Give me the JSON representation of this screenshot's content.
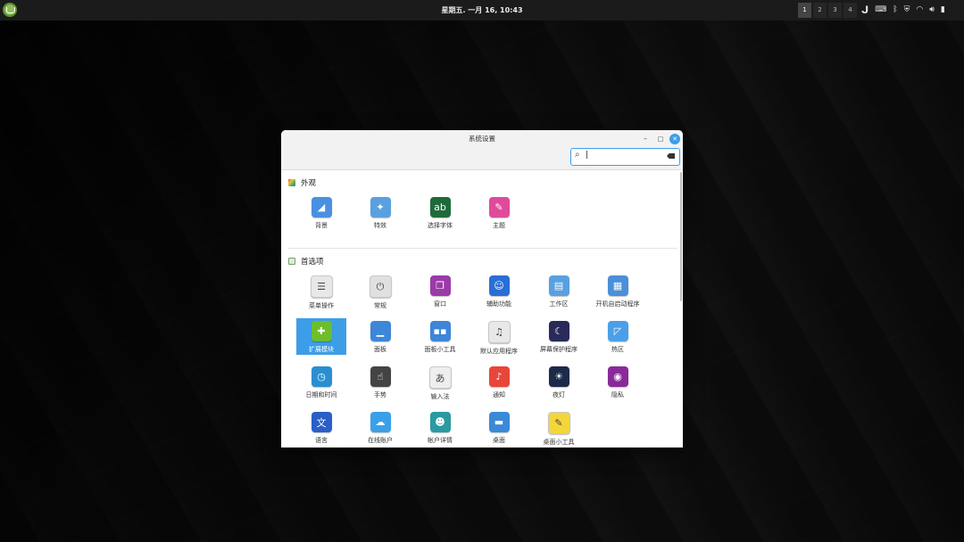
{
  "panel": {
    "clock": "星期五. 一月 16, 10:43",
    "workspaces": [
      "1",
      "2",
      "3",
      "4"
    ],
    "tray_icons": [
      "update-manager-icon",
      "keyboard-icon",
      "bluetooth-icon",
      "shield-icon",
      "wifi-icon",
      "volume-icon",
      "battery-icon"
    ]
  },
  "window": {
    "title": "系统设置",
    "search_value": "|",
    "sections": [
      {
        "title": "外观",
        "items": [
          {
            "label": "背景",
            "icon": "background-icon",
            "color": "#4a90e2"
          },
          {
            "label": "特效",
            "icon": "effects-icon",
            "color": "#5aa0e0"
          },
          {
            "label": "选择字体",
            "icon": "fonts-icon",
            "color": "#1e6b3a"
          },
          {
            "label": "主题",
            "icon": "themes-icon",
            "color": "#e04a9a"
          }
        ]
      },
      {
        "title": "首选项",
        "items": [
          {
            "label": "菜单操作",
            "icon": "menu-icon",
            "color": "#e8e8e8"
          },
          {
            "label": "常规",
            "icon": "general-icon",
            "color": "#e0e0e0"
          },
          {
            "label": "窗口",
            "icon": "windows-icon",
            "color": "#9b3aa8"
          },
          {
            "label": "辅助功能",
            "icon": "accessibility-icon",
            "color": "#2a6fd6"
          },
          {
            "label": "工作区",
            "icon": "workspaces-icon",
            "color": "#5aa0e0"
          },
          {
            "label": "开机自启动程序",
            "icon": "startup-applications-icon",
            "color": "#4a8fd9"
          },
          {
            "label": "扩展模块",
            "icon": "extensions-icon",
            "color": "#6cbf2a",
            "selected": true
          },
          {
            "label": "面板",
            "icon": "panel-icon",
            "color": "#3d86d8"
          },
          {
            "label": "面板小工具",
            "icon": "applets-icon",
            "color": "#3d86d8"
          },
          {
            "label": "默认应用程序",
            "icon": "preferred-applications-icon",
            "color": "#e8e8e8"
          },
          {
            "label": "屏幕保护程序",
            "icon": "screensaver-icon",
            "color": "#2a2a5a"
          },
          {
            "label": "热区",
            "icon": "hot-corners-icon",
            "color": "#4aa0e8"
          },
          {
            "label": "日期和时间",
            "icon": "clock-icon",
            "color": "#2a8fd0"
          },
          {
            "label": "手势",
            "icon": "gestures-icon",
            "color": "#444444"
          },
          {
            "label": "输入法",
            "icon": "input-method-icon",
            "color": "#eeeeee"
          },
          {
            "label": "通知",
            "icon": "notifications-icon",
            "color": "#e8463a"
          },
          {
            "label": "夜灯",
            "icon": "night-light-icon",
            "color": "#1e2a4a"
          },
          {
            "label": "隐私",
            "icon": "privacy-icon",
            "color": "#8a2a9a"
          },
          {
            "label": "语言",
            "icon": "languages-icon",
            "color": "#2a5fc8"
          },
          {
            "label": "在线账户",
            "icon": "online-accounts-icon",
            "color": "#3aa0e8"
          },
          {
            "label": "帐户详情",
            "icon": "account-details-icon",
            "color": "#2a9aa0"
          },
          {
            "label": "桌面",
            "icon": "desktop-icon",
            "color": "#3a8ad8"
          },
          {
            "label": "桌面小工具",
            "icon": "desklets-icon",
            "color": "#f4d63a"
          }
        ]
      }
    ]
  }
}
